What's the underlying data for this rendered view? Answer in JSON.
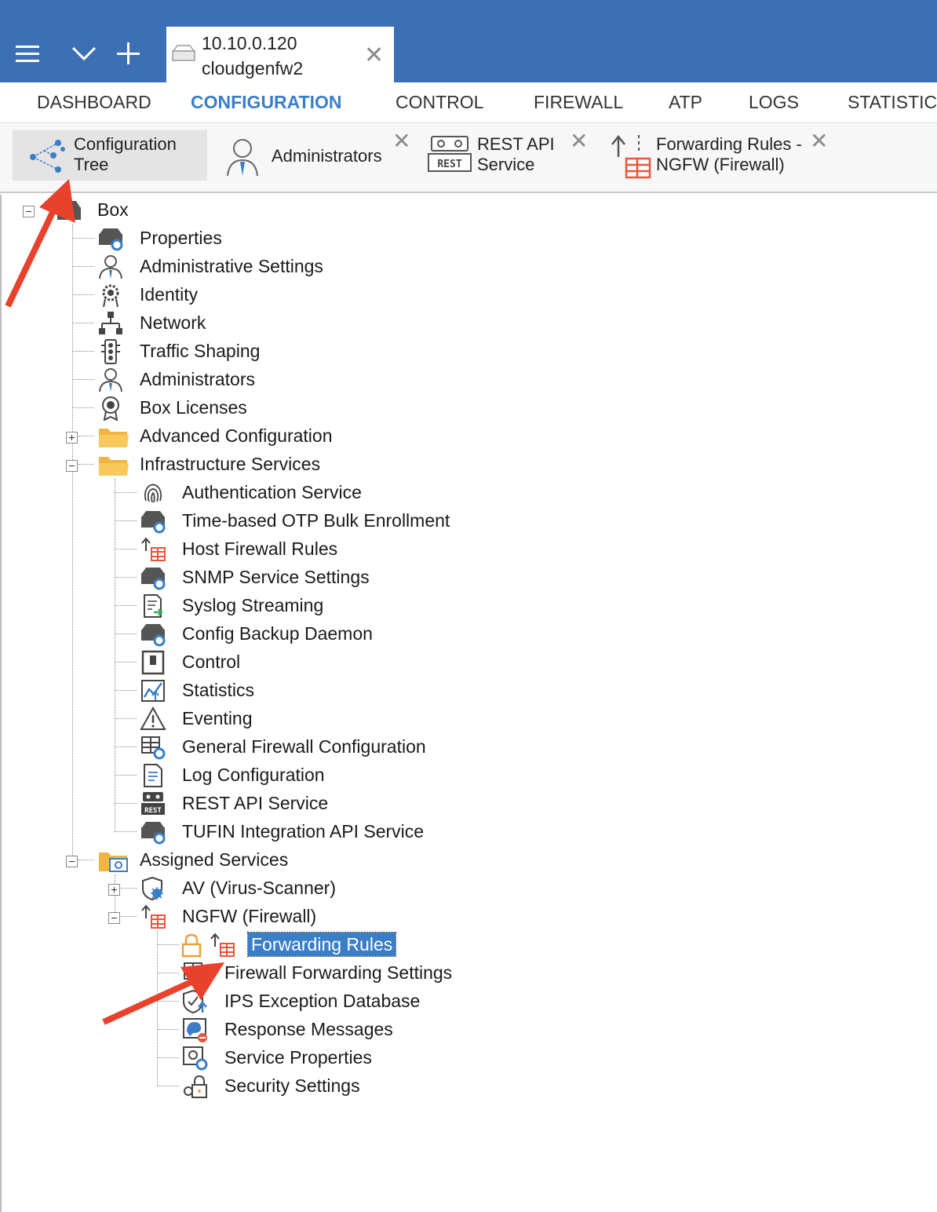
{
  "window": {
    "connection_tab": {
      "host": "10.10.0.120",
      "name": "cloudgenfw2"
    }
  },
  "main_menu": [
    {
      "label": "DASHBOARD",
      "active": false
    },
    {
      "label": "CONFIGURATION",
      "active": true
    },
    {
      "label": "CONTROL",
      "active": false
    },
    {
      "label": "FIREWALL",
      "active": false
    },
    {
      "label": "ATP",
      "active": false
    },
    {
      "label": "LOGS",
      "active": false
    },
    {
      "label": "STATISTICS",
      "active": false
    }
  ],
  "sub_tabs": [
    {
      "line1": "Configuration",
      "line2": "Tree"
    },
    {
      "line1": "Administrators",
      "line2": ""
    },
    {
      "line1": "REST API",
      "line2": "Service"
    },
    {
      "line1": "Forwarding Rules -",
      "line2": "NGFW (Firewall)"
    }
  ],
  "rest_icon_label": "REST",
  "tree": {
    "root": "Box",
    "box_children": [
      "Properties",
      "Administrative Settings",
      "Identity",
      "Network",
      "Traffic Shaping",
      "Administrators",
      "Box Licenses",
      "Advanced Configuration",
      "Infrastructure Services"
    ],
    "infrastructure_children": [
      "Authentication Service",
      "Time-based OTP Bulk Enrollment",
      "Host Firewall Rules",
      "SNMP Service Settings",
      "Syslog Streaming",
      "Config Backup Daemon",
      "Control",
      "Statistics",
      "Eventing",
      "General Firewall Configuration",
      "Log Configuration",
      "REST API Service",
      "TUFIN Integration API Service"
    ],
    "assigned_services": "Assigned Services",
    "assigned_children": [
      "AV (Virus-Scanner)",
      "NGFW (Firewall)"
    ],
    "ngfw_children": [
      "Forwarding Rules",
      "Firewall Forwarding Settings",
      "IPS Exception Database",
      "Response Messages",
      "Service Properties",
      "Security Settings"
    ],
    "selected": "Forwarding Rules"
  },
  "colors": {
    "topbar": "#3c6fb4",
    "accent": "#3a7ec8",
    "annotation_arrow": "#e8412c",
    "folder": "#f2b640"
  }
}
